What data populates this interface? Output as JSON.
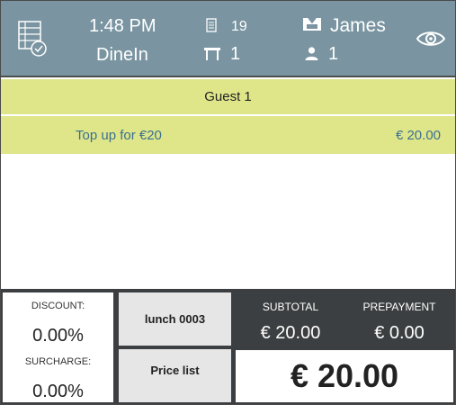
{
  "header": {
    "time": "1:48 PM",
    "order_type": "DineIn",
    "document_number": "19",
    "table_number": "1",
    "waiter": "James",
    "guest_count": "1"
  },
  "guest_section": {
    "label": "Guest 1",
    "items": [
      {
        "name": "Top up for €20",
        "price": "€ 20.00"
      }
    ]
  },
  "bottom": {
    "discount_label": "DISCOUNT:",
    "discount_value": "0.00%",
    "surcharge_label": "SURCHARGE:",
    "surcharge_value": "0.00%",
    "lunch_button": "lunch 0003",
    "price_list_button": "Price list",
    "subtotal_label": "SUBTOTAL",
    "subtotal_value": "€ 20.00",
    "prepayment_label": "PREPAYMENT",
    "prepayment_value": "€ 0.00",
    "total_value": "€ 20.00"
  },
  "icons": {
    "order": "order-list-check-icon",
    "document": "document-icon",
    "table": "table-icon",
    "waiter": "waiter-icon",
    "guest": "person-icon",
    "view": "eye-icon"
  },
  "colors": {
    "header_bg": "#7a95a1",
    "guest_bar_bg": "#dfe68a",
    "item_text": "#3a6f8f",
    "dark_panel": "#3c3f41"
  }
}
